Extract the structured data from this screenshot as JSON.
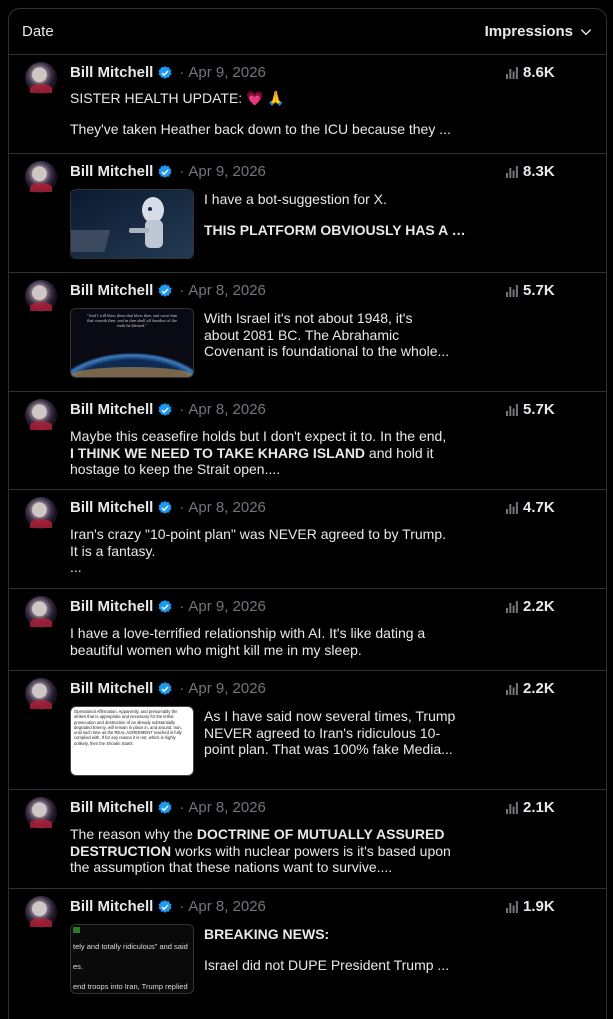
{
  "header": {
    "date_label": "Date",
    "impressions_label": "Impressions"
  },
  "rows": [
    {
      "author": "Bill Mitchell",
      "sep": "·",
      "date": "Apr 9, 2026",
      "impressions": "8.6K",
      "lines": [
        "SISTER HEALTH UPDATE: 💗 🙏",
        "They've taken Heather back down to the ICU because they ..."
      ]
    },
    {
      "author": "Bill Mitchell",
      "sep": "·",
      "date": "Apr 9, 2026",
      "impressions": "8.3K",
      "lines": [
        "I have a bot-suggestion for X.",
        "THIS PLATFORM OBVIOUSLY HAS A BO..."
      ]
    },
    {
      "author": "Bill Mitchell",
      "sep": "·",
      "date": "Apr 8, 2026",
      "impressions": "5.7K",
      "lines": [
        "With Israel it's not about 1948, it's",
        "about 2081 BC. The Abrahamic",
        "Covenant is foundational to the whole..."
      ]
    },
    {
      "author": "Bill Mitchell",
      "sep": "·",
      "date": "Apr 8, 2026",
      "impressions": "5.7K",
      "lines": [
        "Maybe this ceasefire holds but I don't expect it to. In the end,",
        "I THINK WE NEED TO TAKE KHARG ISLAND",
        " and hold it",
        "hostage to keep the Strait open...."
      ]
    },
    {
      "author": "Bill Mitchell",
      "sep": "·",
      "date": "Apr 8, 2026",
      "impressions": "4.7K",
      "lines": [
        "Iran's crazy \"10-point plan\" was NEVER agreed to by Trump.",
        "It is a  fantasy.",
        "..."
      ]
    },
    {
      "author": "Bill Mitchell",
      "sep": "·",
      "date": "Apr 9, 2026",
      "impressions": "2.2K",
      "lines": [
        "I have a love-terrified relationship with AI.  It's like dating a",
        "beautiful women who might kill me in my sleep."
      ]
    },
    {
      "author": "Bill Mitchell",
      "sep": "·",
      "date": "Apr 9, 2026",
      "impressions": "2.2K",
      "lines": [
        "As I have said now several times, Trump",
        "NEVER agreed to Iran's ridiculous 10-",
        "point plan. That was 100% fake Media..."
      ]
    },
    {
      "author": "Bill Mitchell",
      "sep": "·",
      "date": "Apr 8, 2026",
      "impressions": "2.1K",
      "lines": [
        "The reason why the ",
        "DOCTRINE OF MUTUALLY ASSURED",
        "DESTRUCTION",
        " works with nuclear powers is it's based upon",
        "the assumption that these nations want to survive...."
      ]
    },
    {
      "author": "Bill Mitchell",
      "sep": "·",
      "date": "Apr 8, 2026",
      "impressions": "1.9K",
      "lines": [
        "BREAKING NEWS:",
        "Israel did not DUPE President Trump ..."
      ]
    }
  ],
  "thumb_texts": {
    "quote": "\"And I will bless them that bless thee, and curse him that curseth thee: and in thee shall all families of the earth be blessed.\"",
    "article": "Operational Affirmation. Apparently, and presumably the strikes that is appropriate and necessary for the lethal prosecution and destruction of an already substantially degraded Enemy, will remain in place in, and around, Iran, until such time as the REAL AGREEMENT reached is fully complied with. If for any reason it is not, which is highly unlikely, then the Shootin Starts",
    "news": [
      "tely and totally ridiculous\" and said",
      "es.",
      "end troops into Iran, Trump replied"
    ]
  },
  "colors": {
    "bg": "#000000",
    "border": "#2f3336",
    "text": "#e7e9ea",
    "muted": "#71767b",
    "verified": "#1d9bf0"
  }
}
